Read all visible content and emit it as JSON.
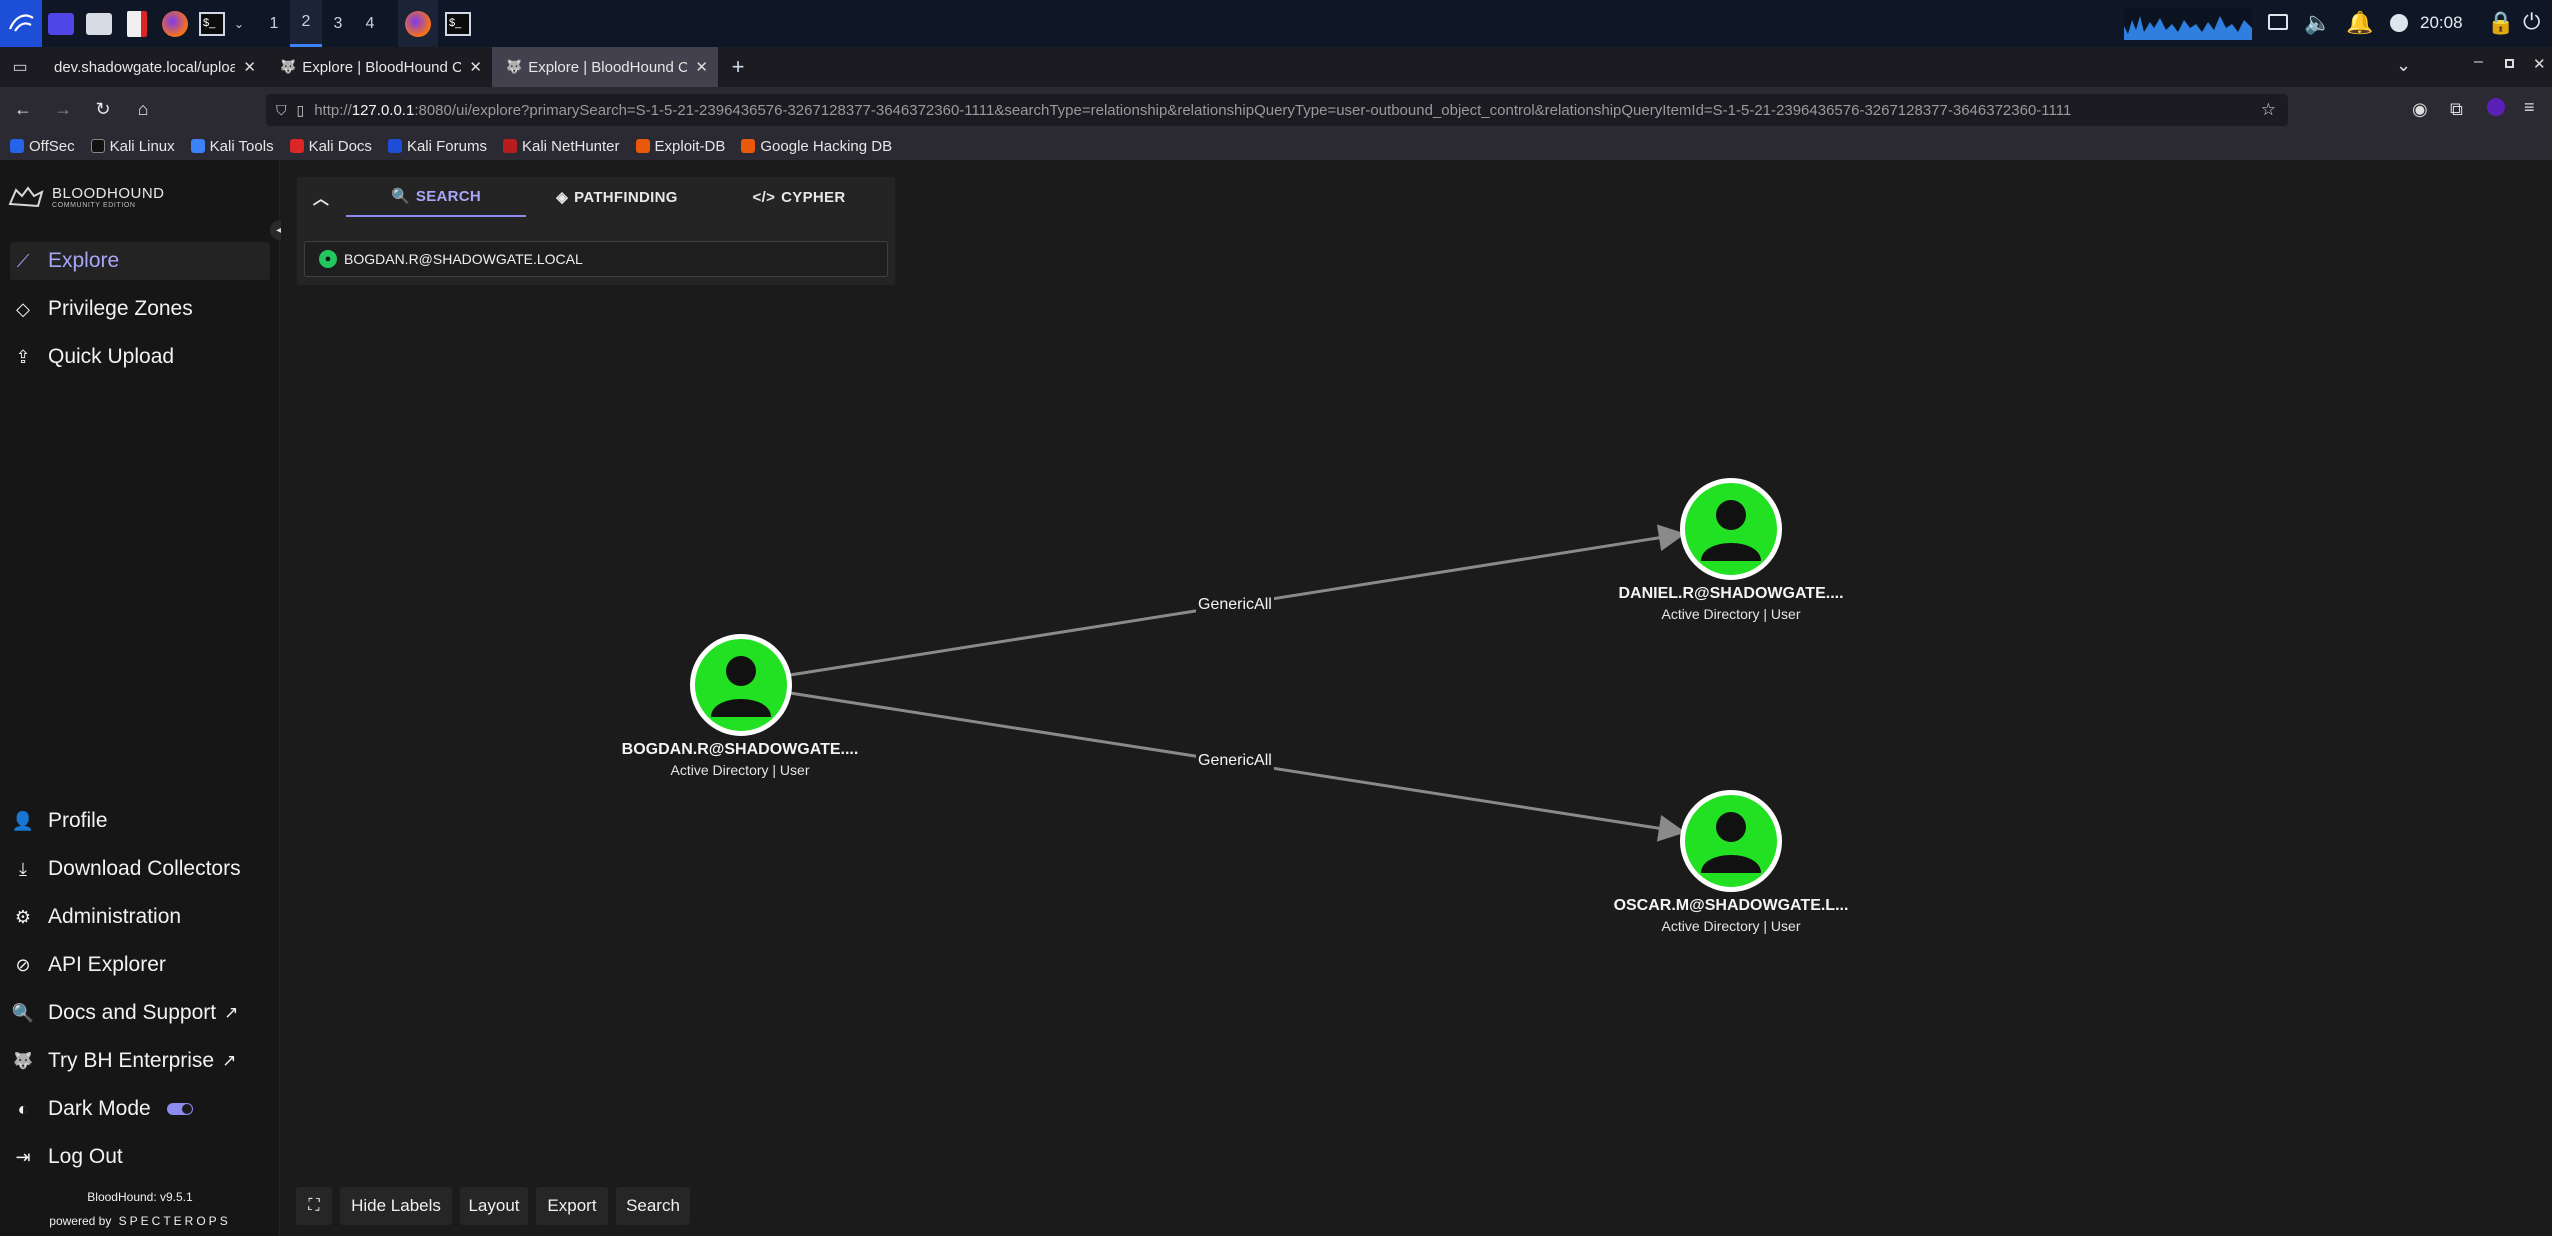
{
  "taskbar": {
    "workspaces": [
      "1",
      "2",
      "3",
      "4"
    ],
    "clock": "20:08"
  },
  "browser": {
    "tabs": [
      {
        "title": "dev.shadowgate.local/uploac"
      },
      {
        "title": "Explore | BloodHound Co"
      },
      {
        "title": "Explore | BloodHound Co"
      }
    ],
    "url_prefix": "http://",
    "url_host": "127.0.0.1",
    "url_rest": ":8080/ui/explore?primarySearch=S-1-5-21-2396436576-3267128377-3646372360-1111&searchType=relationship&relationshipQueryType=user-outbound_object_control&relationshipQueryItemId=S-1-5-21-2396436576-3267128377-3646372360-1111",
    "bookmarks": [
      "OffSec",
      "Kali Linux",
      "Kali Tools",
      "Kali Docs",
      "Kali Forums",
      "Kali NetHunter",
      "Exploit-DB",
      "Google Hacking DB"
    ]
  },
  "app": {
    "logo_title": "BLOODHOUND",
    "logo_sub": "COMMUNITY EDITION",
    "nav_top": [
      "Explore",
      "Privilege Zones",
      "Quick Upload"
    ],
    "nav_bottom": [
      "Profile",
      "Download Collectors",
      "Administration",
      "API Explorer",
      "Docs and Support",
      "Try BH Enterprise",
      "Dark Mode",
      "Log Out"
    ],
    "version": "BloodHound: v9.5.1",
    "powered_by": "powered by",
    "powered_brand": "SPECTEROPS"
  },
  "search": {
    "tabs": [
      "SEARCH",
      "PATHFINDING",
      "CYPHER"
    ],
    "value": "BOGDAN.R@SHADOWGATE.LOCAL"
  },
  "graph": {
    "nodes": [
      {
        "label": "BOGDAN.R@SHADOWGATE....",
        "sub": "Active Directory | User"
      },
      {
        "label": "DANIEL.R@SHADOWGATE....",
        "sub": "Active Directory | User"
      },
      {
        "label": "OSCAR.M@SHADOWGATE.L...",
        "sub": "Active Directory | User"
      }
    ],
    "edges": [
      {
        "label": "GenericAll"
      },
      {
        "label": "GenericAll"
      }
    ]
  },
  "toolbar": {
    "buttons": [
      "Hide Labels",
      "Layout",
      "Export",
      "Search"
    ]
  },
  "colors": {
    "accent": "#a8a6f7",
    "node": "#22e022",
    "edge": "#8a8a8a"
  }
}
